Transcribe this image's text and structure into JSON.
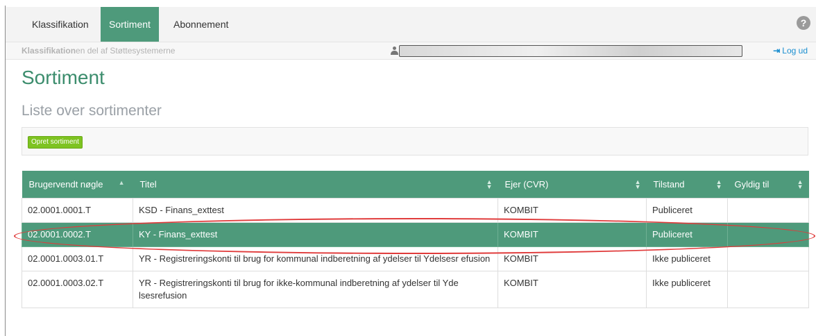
{
  "nav": {
    "tabs": [
      {
        "label": "Klassifikation"
      },
      {
        "label": "Sortiment"
      },
      {
        "label": "Abonnement"
      }
    ],
    "help_icon": "question-circle-icon"
  },
  "subbar": {
    "app_bold": "Klassifikation",
    "app_rest": "en del af Støttesystemerne",
    "logout": "Log ud"
  },
  "page": {
    "title": "Sortiment",
    "subtitle": "Liste over sortimenter",
    "create_button": "Opret sortiment"
  },
  "table": {
    "columns": [
      "Brugervendt nøgle",
      "Titel",
      "Ejer (CVR)",
      "Tilstand",
      "Gyldig til"
    ],
    "rows": [
      {
        "key": "02.0001.0001.T",
        "title": "KSD - Finans_exttest",
        "owner": "KOMBIT",
        "state": "Publiceret",
        "valid": ""
      },
      {
        "key": "02.0001.0002.T",
        "title": "KY - Finans_exttest",
        "owner": "KOMBIT",
        "state": "Publiceret",
        "valid": ""
      },
      {
        "key": "02.0001.0003.01.T",
        "title": "YR - Registreringskonti til brug for kommunal indberetning af ydelser til Ydelsesr efusion",
        "owner": "KOMBIT",
        "state": "Ikke publiceret",
        "valid": ""
      },
      {
        "key": "02.0001.0003.02.T",
        "title": "YR - Registreringskonti til brug for ikke-kommunal indberetning af ydelser til Yde lsesrefusion",
        "owner": "KOMBIT",
        "state": "Ikke publiceret",
        "valid": ""
      }
    ],
    "selected_row_index": 1
  },
  "colors": {
    "accent": "#4e9a7b",
    "title": "#3c8d6d",
    "button": "#7ec321",
    "annotation": "#e03b3b"
  }
}
